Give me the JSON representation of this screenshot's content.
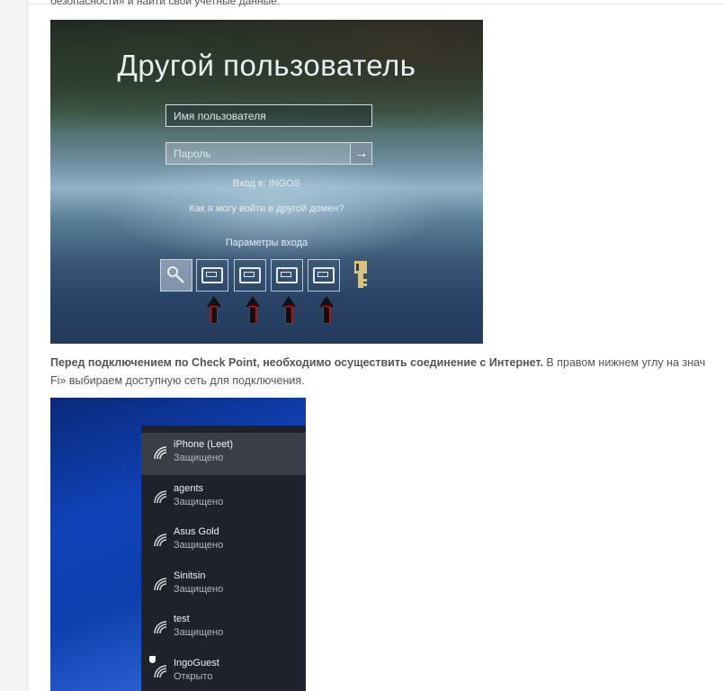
{
  "article": {
    "top_line": "безопасности» и найти свой учетные данные.",
    "paragraph_bold": "Перед подключением по Check Point, необходимо осуществить соединение с Интернет.",
    "paragraph_rest": " В правом нижнем углу на знач",
    "paragraph_line2": "Fi» выбираем доступную сеть для подключения."
  },
  "login_screenshot": {
    "title": "Другой пользователь",
    "username_placeholder": "Имя пользователя",
    "password_placeholder": "Пароль",
    "submit_glyph": "→",
    "domain_text": "Вход в: INGOS",
    "other_domain_link": "Как я могу войти в другой домен?",
    "sign_in_options": "Параметры входа"
  },
  "wifi_screenshot": {
    "networks": [
      {
        "name": "iPhone (Leet)",
        "status": "Защищено",
        "active": true
      },
      {
        "name": "agents",
        "status": "Защищено",
        "active": false
      },
      {
        "name": "Asus Gold",
        "status": "Защищено",
        "active": false
      },
      {
        "name": "Sinitsin",
        "status": "Защищено",
        "active": false
      },
      {
        "name": "test",
        "status": "Защищено",
        "active": false
      },
      {
        "name": "IngoGuest",
        "status": "Открыто",
        "active": false,
        "shield": true
      }
    ]
  }
}
